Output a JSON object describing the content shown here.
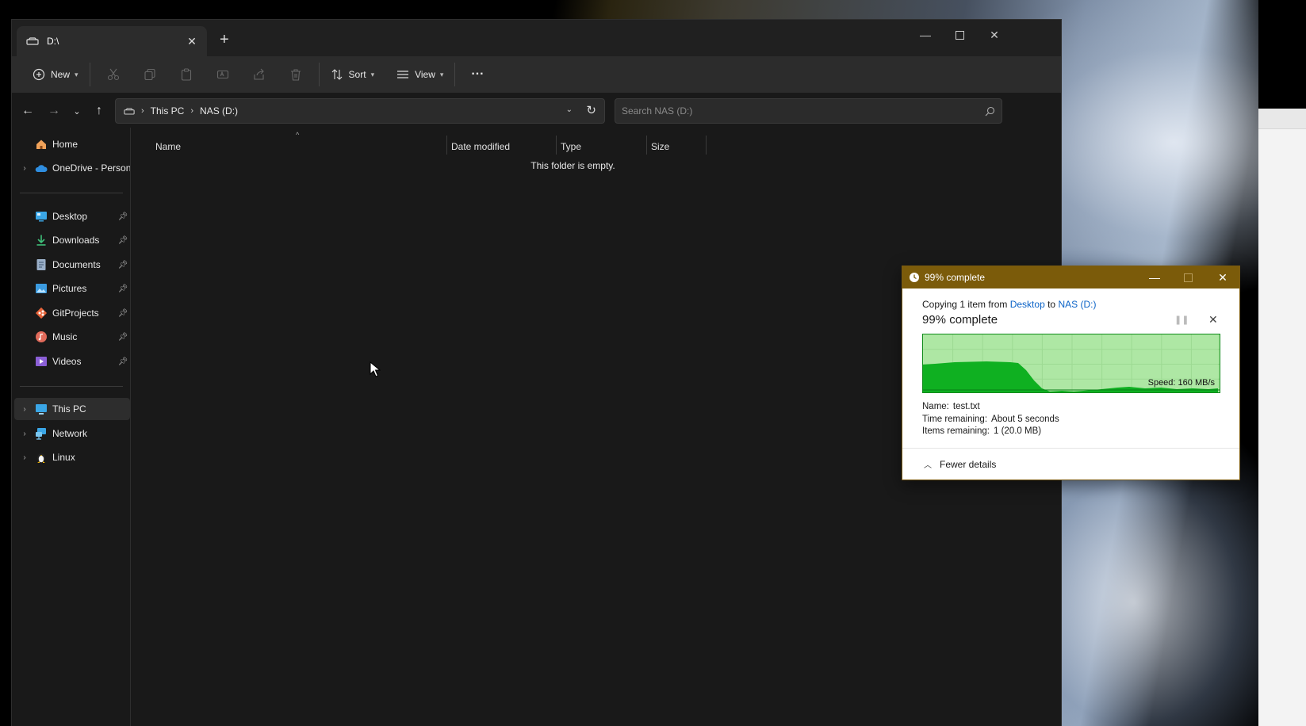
{
  "explorer": {
    "tab_title": "D:\\",
    "new_tab": "+",
    "toolbar": {
      "new_label": "New",
      "sort_label": "Sort",
      "view_label": "View",
      "more_label": "···"
    },
    "address": {
      "crumbs": [
        "This PC",
        "NAS (D:)"
      ],
      "search_placeholder": "Search NAS (D:)"
    },
    "sidebar": {
      "home": "Home",
      "onedrive": "OneDrive - Persona",
      "quick_access": [
        "Desktop",
        "Downloads",
        "Documents",
        "Pictures",
        "GitProjects",
        "Music",
        "Videos"
      ],
      "this_pc": "This PC",
      "network": "Network",
      "linux": "Linux"
    },
    "columns": {
      "name": "Name",
      "date_modified": "Date modified",
      "type": "Type",
      "size": "Size"
    },
    "empty_message": "This folder is empty."
  },
  "copy_dialog": {
    "title": "99% complete",
    "copying_prefix": "Copying 1 item from",
    "source": "Desktop",
    "to_word": "to",
    "destination": "NAS (D:)",
    "heading": "99% complete",
    "progress_percent": 99,
    "speed_text": "Speed: 160 MB/s",
    "name_label": "Name:",
    "name_value": "test.txt",
    "time_label": "Time remaining:",
    "time_value": "About 5 seconds",
    "items_label": "Items remaining:",
    "items_value": "1 (20.0 MB)",
    "fewer_details": "Fewer details"
  },
  "colors": {
    "dialog_title_bar": "#7b5b0a",
    "graph_fill": "#0fb021",
    "graph_background": "#a9e59e",
    "link": "#0b63c7"
  }
}
